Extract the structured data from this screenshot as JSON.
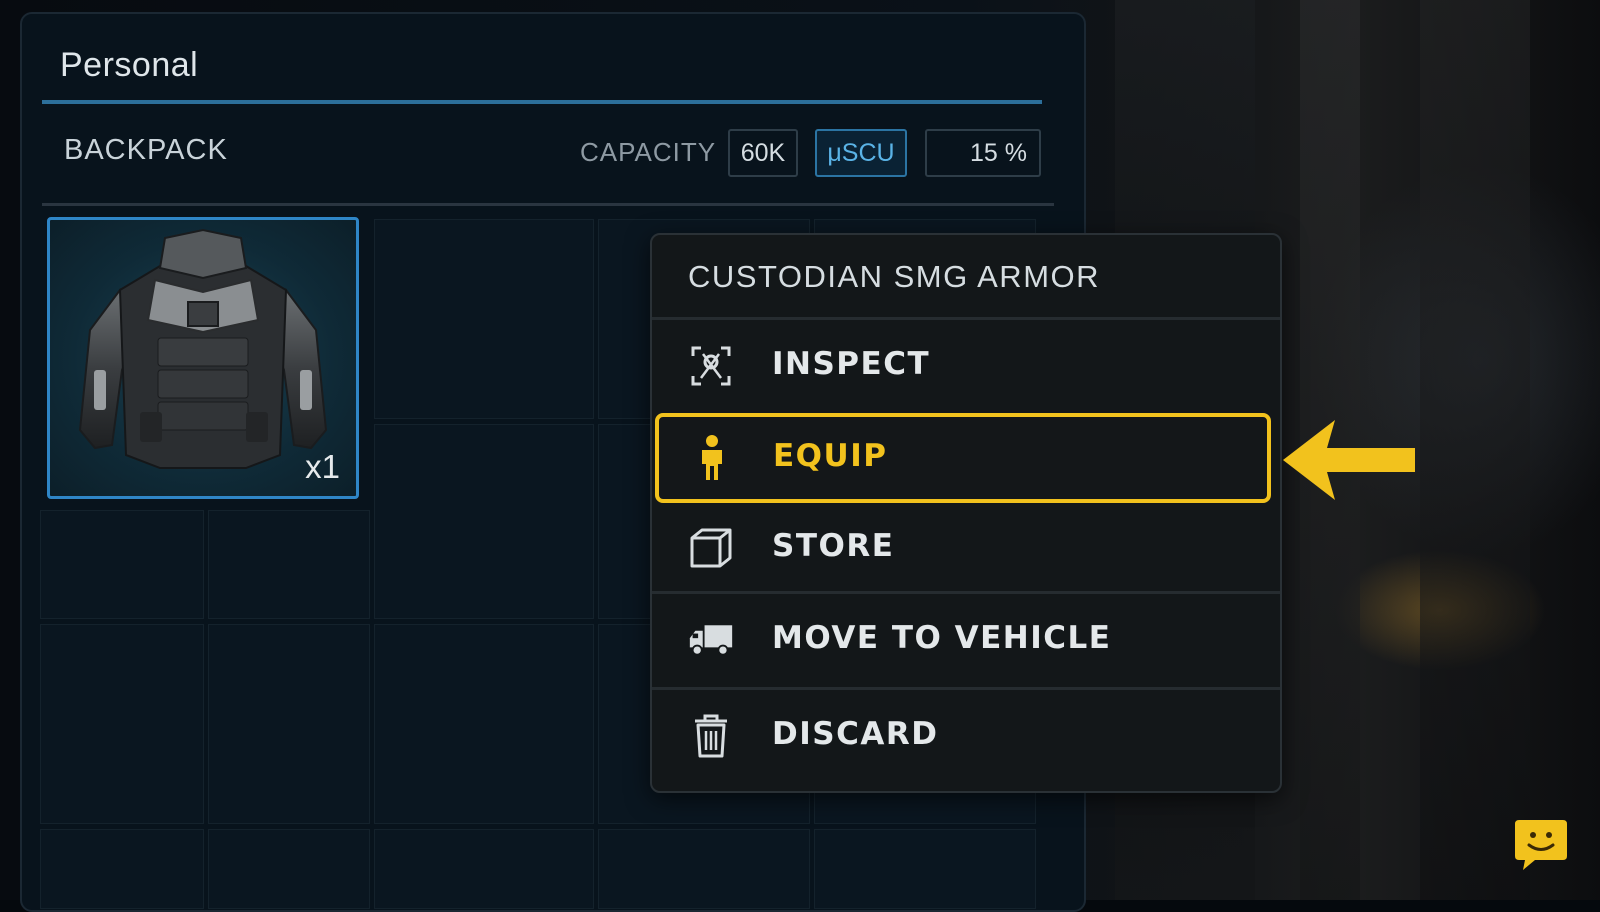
{
  "panel": {
    "title": "Personal",
    "section_label": "BACKPACK",
    "capacity": {
      "label": "CAPACITY",
      "value": "60K",
      "unit": "μSCU",
      "percent": "15 %"
    }
  },
  "inventory": {
    "items": [
      {
        "name": "armor-jacket-icon",
        "quantity": "x1",
        "selected": true
      }
    ]
  },
  "context_menu": {
    "title": "CUSTODIAN SMG ARMOR",
    "items": [
      {
        "label": "INSPECT",
        "icon": "inspect-icon"
      },
      {
        "label": "EQUIP",
        "icon": "person-icon",
        "highlighted": true
      },
      {
        "label": "STORE",
        "icon": "box-icon"
      },
      {
        "label": "MOVE TO VEHICLE",
        "icon": "truck-icon"
      },
      {
        "label": "DISCARD",
        "icon": "trash-icon"
      }
    ]
  },
  "colors": {
    "accent_blue": "#2f86c7",
    "highlight_yellow": "#f2c21d",
    "panel_bg": "#08131c",
    "menu_bg": "#131719"
  }
}
